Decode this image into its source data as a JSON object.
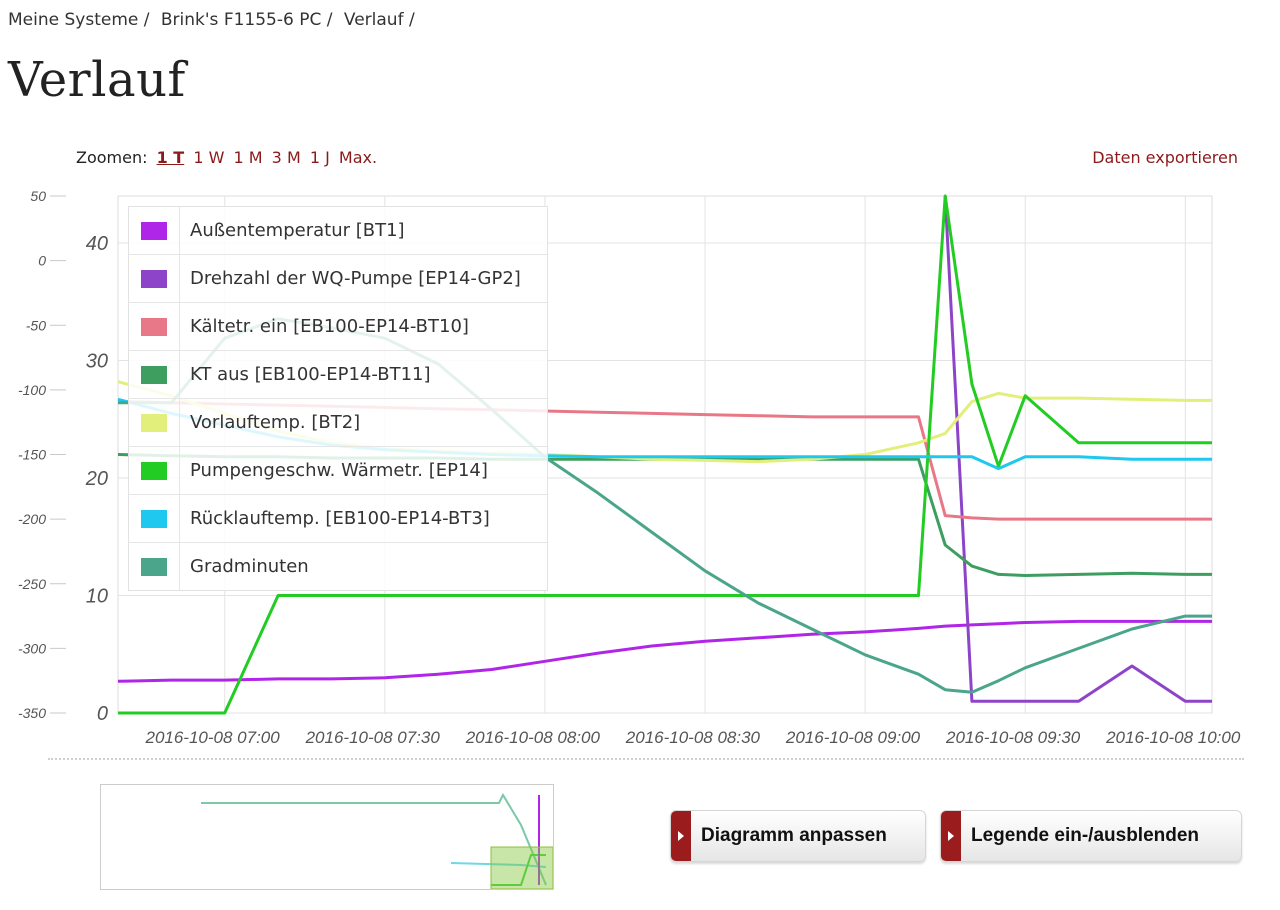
{
  "breadcrumb": [
    "Meine Systeme",
    "Brink's F1155-6 PC",
    "Verlauf"
  ],
  "page_title": "Verlauf",
  "zoom": {
    "label": "Zoomen:",
    "options": [
      "1 T",
      "1 W",
      "1 M",
      "3 M",
      "1 J",
      "Max."
    ],
    "active": "1 T"
  },
  "export_label": "Daten exportieren",
  "buttons": {
    "customize": "Diagramm anpassen",
    "toggle_legend": "Legende ein-/ausblenden"
  },
  "legend": [
    {
      "label": "Außentemperatur [BT1]",
      "color": "#b026e8"
    },
    {
      "label": "Drehzahl der WQ-Pumpe [EP14-GP2]",
      "color": "#8e44c9"
    },
    {
      "label": "Kältetr. ein [EB100-EP14-BT10]",
      "color": "#e87887"
    },
    {
      "label": "KT aus [EB100-EP14-BT11]",
      "color": "#3d9e5f"
    },
    {
      "label": "Vorlauftemp. [BT2]",
      "color": "#e2ef7a"
    },
    {
      "label": "Pumpengeschw. Wärmetr. [EP14]",
      "color": "#22cc22"
    },
    {
      "label": "Rücklauftemp. [EB100-EP14-BT3]",
      "color": "#1ec8ee"
    },
    {
      "label": "Gradminuten",
      "color": "#4aa58a"
    }
  ],
  "chart_data": {
    "type": "line",
    "grid": true,
    "x": [
      "06:40",
      "06:50",
      "07:00",
      "07:10",
      "07:20",
      "07:30",
      "07:40",
      "07:50",
      "08:00",
      "08:10",
      "08:20",
      "08:30",
      "08:40",
      "08:50",
      "09:00",
      "09:10",
      "09:15",
      "09:20",
      "09:25",
      "09:30",
      "09:40",
      "09:50",
      "10:00",
      "10:05"
    ],
    "x_tick_labels": [
      "2016-10-08 07:00",
      "2016-10-08 07:30",
      "2016-10-08 08:00",
      "2016-10-08 08:30",
      "2016-10-08 09:00",
      "2016-10-08 09:30",
      "2016-10-08 10:00"
    ],
    "y_left_ticks": [
      "50",
      "0",
      "-50",
      "-100",
      "-150",
      "-200",
      "-250",
      "-300",
      "-350"
    ],
    "y_left_range": [
      -350,
      50
    ],
    "y_right_ticks": [
      "40",
      "30",
      "20",
      "10",
      "0"
    ],
    "y_right_range": [
      0,
      44
    ],
    "series": [
      {
        "name": "Außentemperatur [BT1]",
        "axis": "right",
        "values": [
          2.7,
          2.8,
          2.8,
          2.9,
          2.9,
          3.0,
          3.3,
          3.7,
          4.4,
          5.1,
          5.7,
          6.1,
          6.4,
          6.7,
          6.9,
          7.2,
          7.4,
          7.5,
          7.6,
          7.7,
          7.8,
          7.8,
          7.8,
          7.8
        ]
      },
      {
        "name": "Drehzahl der WQ-Pumpe [EP14-GP2]",
        "axis": "right",
        "values": [
          null,
          null,
          null,
          null,
          null,
          null,
          null,
          null,
          null,
          null,
          null,
          null,
          null,
          null,
          null,
          null,
          44,
          1,
          1,
          1,
          1,
          4,
          1,
          1
        ]
      },
      {
        "name": "Kältetr. ein [EB100-EP14-BT10]",
        "axis": "right",
        "values": [
          26.5,
          26.4,
          26.3,
          26.2,
          26.1,
          26.0,
          25.9,
          25.8,
          25.7,
          25.6,
          25.5,
          25.4,
          25.3,
          25.2,
          25.2,
          25.2,
          16.8,
          16.6,
          16.5,
          16.5,
          16.5,
          16.5,
          16.5,
          16.5
        ]
      },
      {
        "name": "KT aus [EB100-EP14-BT11]",
        "axis": "right",
        "values": [
          22.0,
          21.9,
          21.8,
          21.8,
          21.7,
          21.7,
          21.7,
          21.6,
          21.6,
          21.6,
          21.6,
          21.6,
          21.6,
          21.6,
          21.6,
          21.6,
          14.3,
          12.5,
          11.8,
          11.7,
          11.8,
          11.9,
          11.8,
          11.8
        ]
      },
      {
        "name": "Vorlauftemp. [BT2]",
        "axis": "right",
        "values": [
          28.2,
          27.0,
          25.5,
          24.0,
          23.0,
          22.5,
          22.3,
          22.1,
          22.0,
          21.8,
          21.6,
          21.5,
          21.4,
          21.6,
          22.0,
          23.0,
          23.8,
          26.5,
          27.2,
          26.8,
          26.8,
          26.7,
          26.6,
          26.6
        ]
      },
      {
        "name": "Pumpengeschw. Wärmetr. [EP14]",
        "axis": "right",
        "values": [
          0,
          0,
          0,
          10,
          10,
          10,
          10,
          10,
          10,
          10,
          10,
          10,
          10,
          10,
          10,
          10,
          44,
          28,
          21,
          27,
          23,
          23,
          23,
          23
        ]
      },
      {
        "name": "Rücklauftemp. [EB100-EP14-BT3]",
        "axis": "right",
        "values": [
          26.7,
          25.5,
          24.5,
          23.5,
          22.8,
          22.4,
          22.2,
          22.0,
          21.9,
          21.8,
          21.8,
          21.8,
          21.8,
          21.8,
          21.8,
          21.8,
          21.8,
          21.8,
          20.8,
          21.8,
          21.8,
          21.6,
          21.6,
          21.6
        ]
      },
      {
        "name": "Gradminuten",
        "axis": "left",
        "values": [
          -110,
          -110,
          -60,
          -45,
          -52,
          -60,
          -80,
          -115,
          -152,
          -180,
          -210,
          -240,
          -265,
          -285,
          -305,
          -320,
          -332,
          -334,
          -325,
          -315,
          -300,
          -285,
          -275,
          -275
        ]
      }
    ]
  }
}
